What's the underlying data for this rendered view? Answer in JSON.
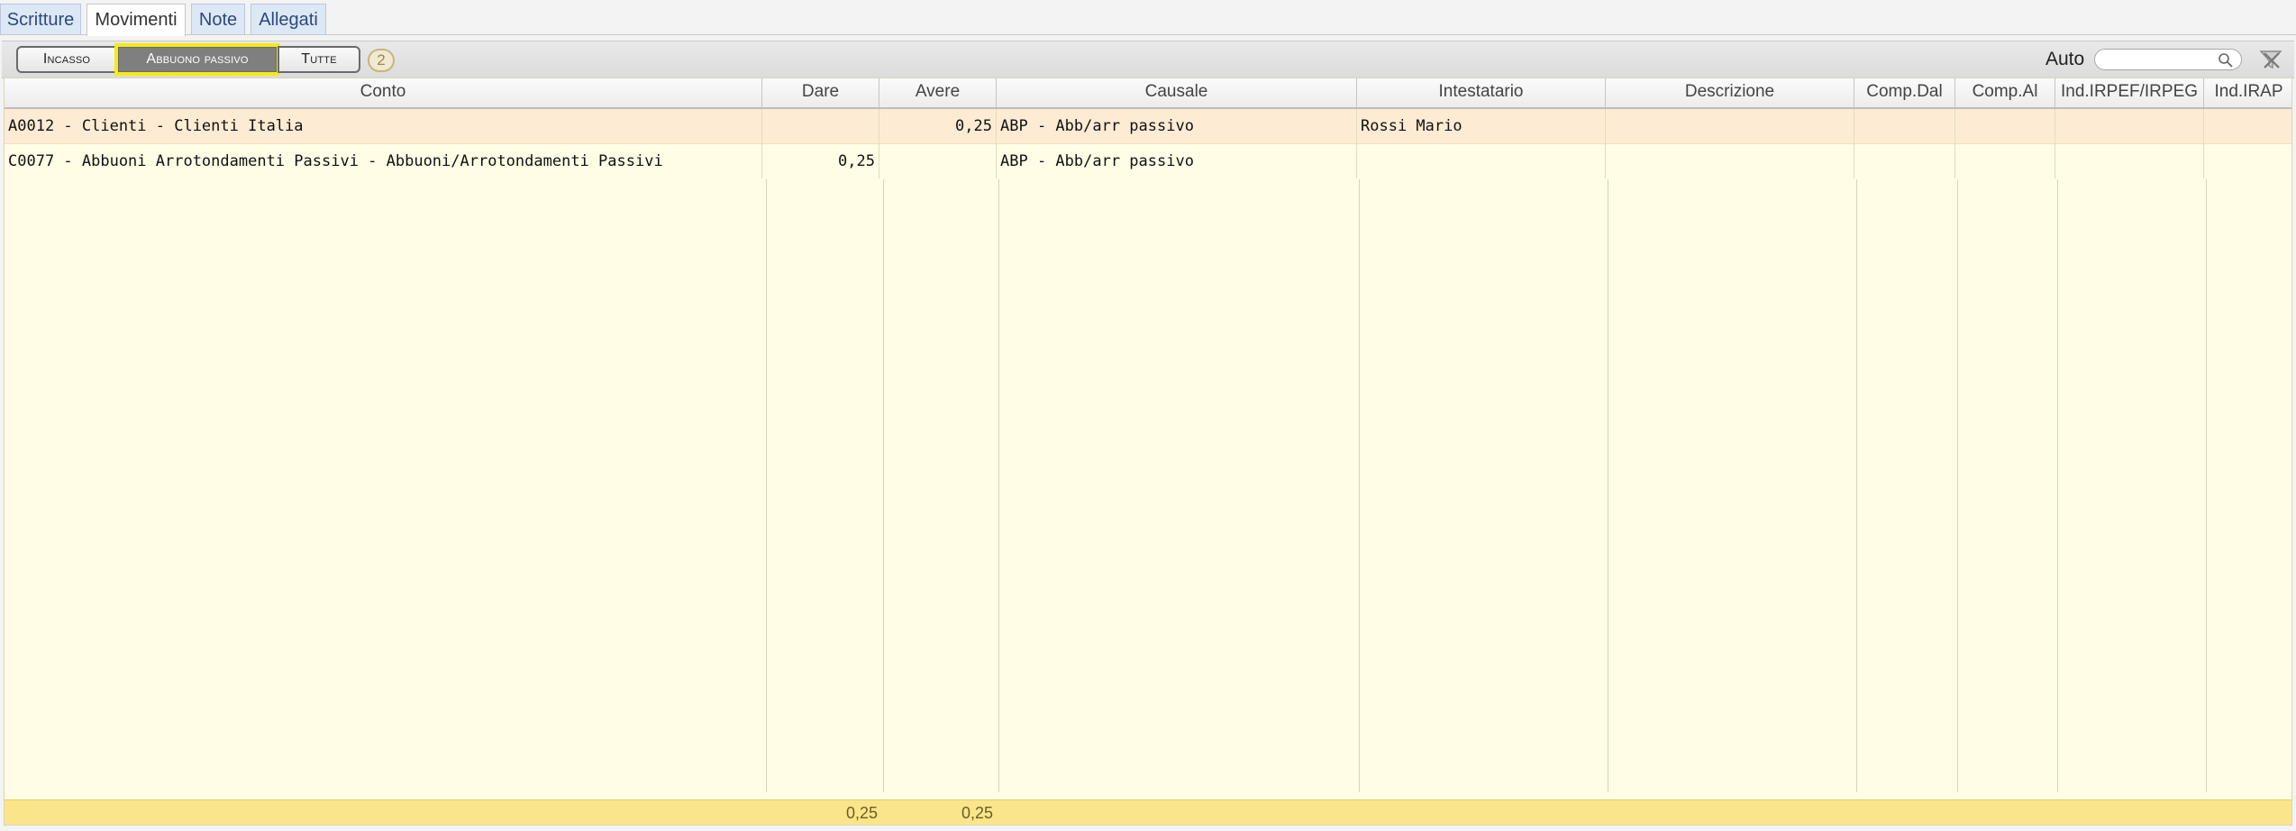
{
  "tabs": [
    {
      "label": "Scritture",
      "active": false
    },
    {
      "label": "Movimenti",
      "active": true
    },
    {
      "label": "Note",
      "active": false
    },
    {
      "label": "Allegati",
      "active": false
    }
  ],
  "toolbar": {
    "filters": [
      {
        "label": "Incasso",
        "selected": false
      },
      {
        "label": "Abbuono passivo",
        "selected": true
      },
      {
        "label": "Tutte",
        "selected": false
      }
    ],
    "count": "2",
    "auto_label": "Auto",
    "search_value": "",
    "highlight_color": "#f5ea1a"
  },
  "grid": {
    "columns": [
      "Conto",
      "Dare",
      "Avere",
      "Causale",
      "Intestatario",
      "Descrizione",
      "Comp.Dal",
      "Comp.Al",
      "Ind.IRPEF/IRPEG",
      "Ind.IRAP"
    ],
    "rows": [
      {
        "conto": "A0012 - Clienti - Clienti Italia",
        "dare": "",
        "avere": "0,25",
        "causale": "ABP - Abb/arr passivo",
        "intestatario": "Rossi Mario",
        "descrizione": "",
        "comp_dal": "",
        "comp_al": "",
        "ind_irpef": "",
        "ind_irap": ""
      },
      {
        "conto": "C0077 - Abbuoni Arrotondamenti Passivi - Abbuoni/Arrotondamenti Passivi",
        "dare": "0,25",
        "avere": "",
        "causale": "ABP - Abb/arr passivo",
        "intestatario": "",
        "descrizione": "",
        "comp_dal": "",
        "comp_al": "",
        "ind_irpef": "",
        "ind_irap": ""
      }
    ],
    "totals": {
      "dare": "0,25",
      "avere": "0,25"
    }
  },
  "colors": {
    "grid_background": "#fffde6",
    "selected_row": "#fdecd3",
    "totals_bar": "#fbe58a",
    "tab_inactive": "#dde8f6"
  }
}
